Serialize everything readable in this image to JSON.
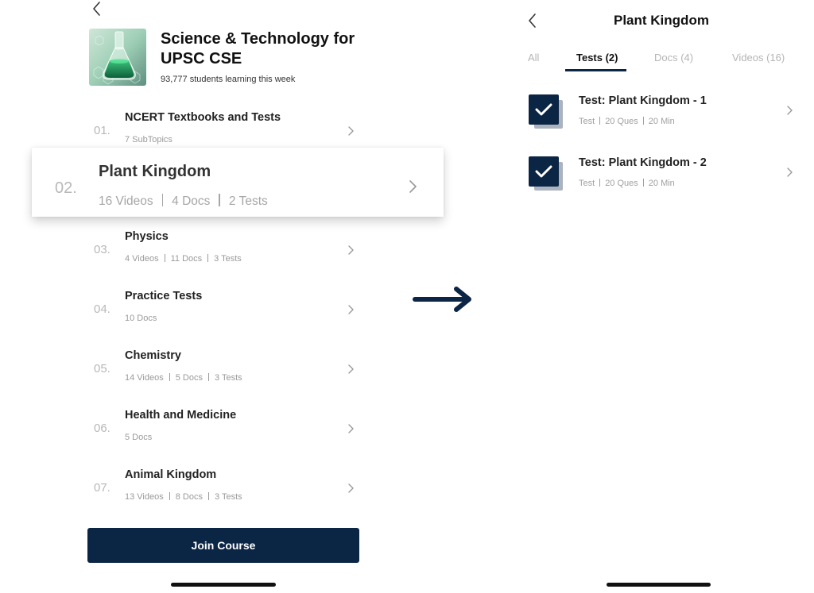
{
  "left": {
    "course": {
      "title": "Science & Technology for UPSC CSE",
      "students": "93,777 students learning this week",
      "thumbnail_icon": "flask-image"
    },
    "chapters": [
      {
        "num": "01.",
        "title": "NCERT Textbooks and Tests",
        "meta": [
          "7 SubTopics"
        ]
      },
      {
        "num": "02.",
        "title": "Plant Kingdom",
        "meta": [
          "16 Videos",
          "4 Docs",
          "2 Tests"
        ]
      },
      {
        "num": "03.",
        "title": "Physics",
        "meta": [
          "4 Videos",
          "11 Docs",
          "3 Tests"
        ]
      },
      {
        "num": "04.",
        "title": "Practice Tests",
        "meta": [
          "10 Docs"
        ]
      },
      {
        "num": "05.",
        "title": "Chemistry",
        "meta": [
          "14 Videos",
          "5 Docs",
          "3 Tests"
        ]
      },
      {
        "num": "06.",
        "title": "Health and Medicine",
        "meta": [
          "5 Docs"
        ]
      },
      {
        "num": "07.",
        "title": "Animal Kingdom",
        "meta": [
          "13 Videos",
          "8 Docs",
          "3 Tests"
        ]
      }
    ],
    "join_label": "Join Course"
  },
  "right": {
    "title": "Plant Kingdom",
    "tabs": [
      {
        "label": "All",
        "active": false
      },
      {
        "label": "Tests (2)",
        "active": true
      },
      {
        "label": "Docs (4)",
        "active": false
      },
      {
        "label": "Videos (16)",
        "active": false
      }
    ],
    "tests": [
      {
        "title": "Test: Plant Kingdom - 1",
        "meta": [
          "Test",
          "20 Ques",
          "20 Min"
        ]
      },
      {
        "title": "Test: Plant Kingdom - 2",
        "meta": [
          "Test",
          "20 Ques",
          "20 Min"
        ]
      }
    ]
  },
  "colors": {
    "primary": "#0b2545",
    "muted": "#9a9a9a",
    "check_shadow": "#aab3bf"
  }
}
